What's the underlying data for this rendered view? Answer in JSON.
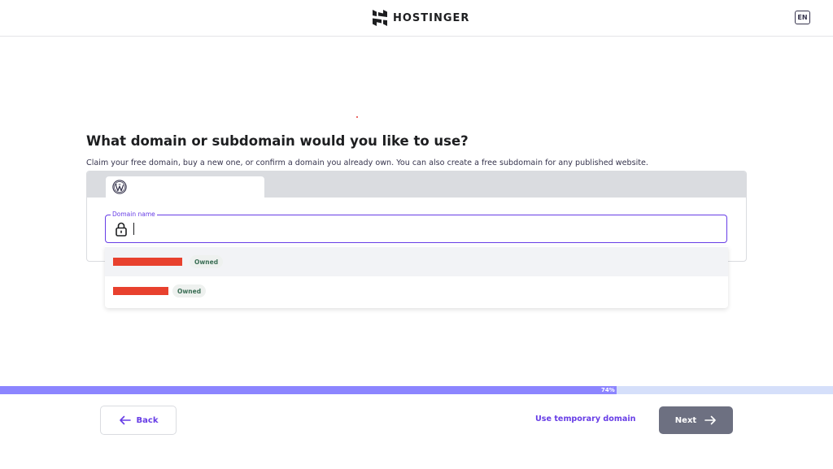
{
  "header": {
    "brand": "HOSTINGER",
    "language": "EN"
  },
  "main": {
    "title": "What domain or subdomain would you like to use?",
    "subtitle": "Claim your free domain, buy a new one, or confirm a domain you already own. You can also create a free subdomain for any published website.",
    "tab_icon": "wordpress-icon",
    "field": {
      "label": "Domain name",
      "value": "",
      "icon": "lock-icon"
    },
    "suggestions": [
      {
        "domain": "[redacted]",
        "badge": "Owned"
      },
      {
        "domain": "[redacted]",
        "badge": "Owned"
      }
    ]
  },
  "progress": {
    "percent": 74,
    "label": "74%"
  },
  "footer": {
    "back_label": "Back",
    "temp_domain_label": "Use temporary domain",
    "next_label": "Next"
  },
  "colors": {
    "accent": "#673de6",
    "progress_fill": "#8c85ff",
    "progress_track": "#d5dffa",
    "next_button": "#6d7081",
    "redaction": "#e8412e"
  }
}
